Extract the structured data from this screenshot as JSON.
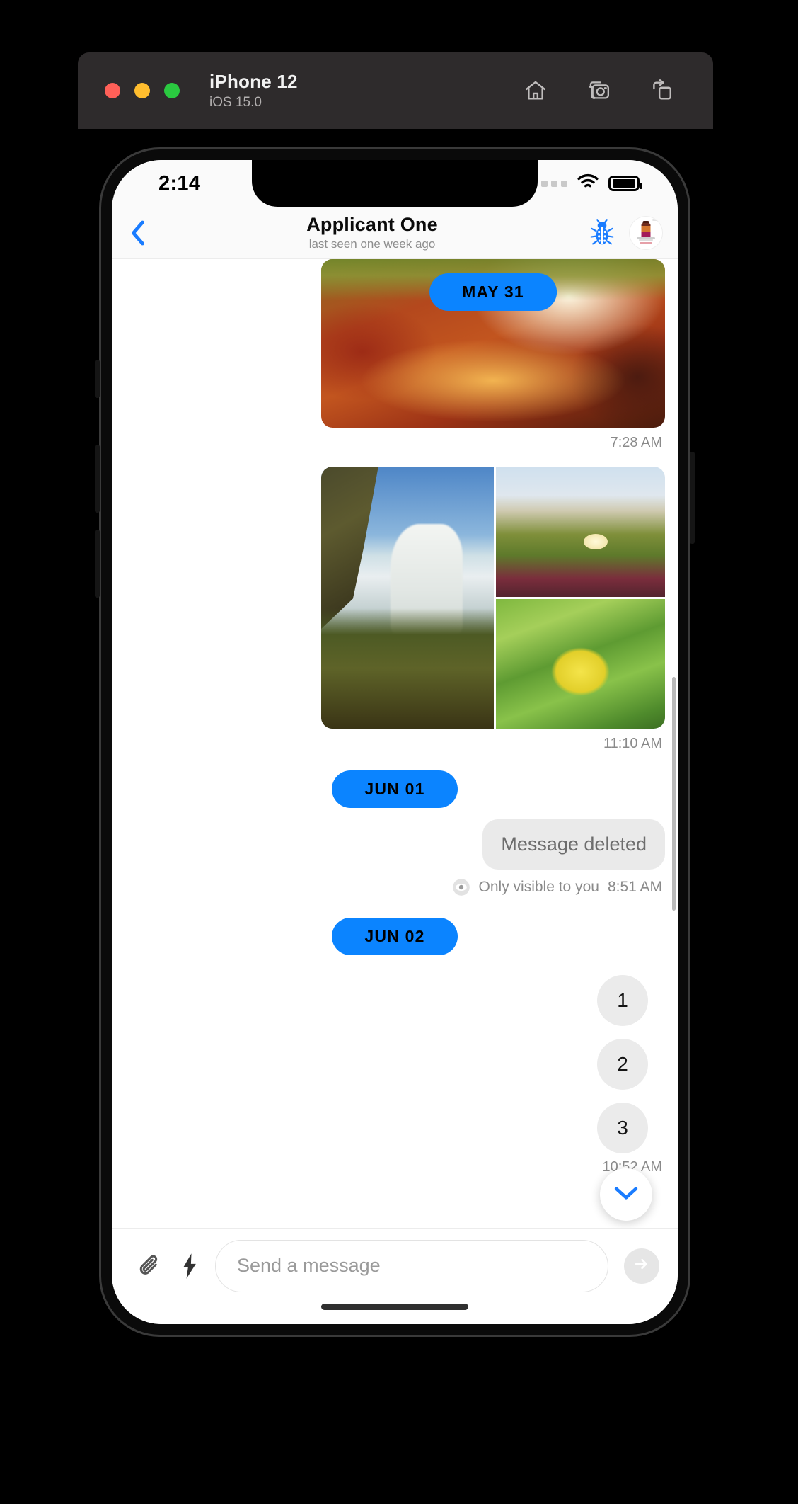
{
  "simulator": {
    "device_name": "iPhone 12",
    "os_version": "iOS 15.0",
    "traffic_lights": [
      "close",
      "minimize",
      "zoom"
    ],
    "toolbar_icons": [
      "home-icon",
      "screenshot-camera-icon",
      "rotate-icon"
    ],
    "colors": {
      "bar_bg": "#2e2b2c",
      "close": "#ff6058",
      "minimize": "#ffbd2e",
      "zoom": "#2ac940"
    }
  },
  "status_bar": {
    "time": "2:14",
    "signal": "signal-dots-icon",
    "wifi": "wifi-icon",
    "battery": "battery-full-icon"
  },
  "chat_header": {
    "back": "chevron-left-icon",
    "title": "Applicant  One",
    "subtitle": "last seen one week ago",
    "bug_icon": "bug-icon",
    "avatar": "avatar",
    "accent": "#0b84ff"
  },
  "messages": [
    {
      "type": "photo",
      "photo_name": "autumn-forest-path",
      "overlay_pill": "MAY 31",
      "timestamp": "7:28 AM"
    },
    {
      "type": "album",
      "photos": [
        "waterfall-mossy-rocks",
        "ice-plant-dune-flowers",
        "lemon-tree-leaves"
      ],
      "timestamp": "11:10 AM"
    },
    {
      "type": "date_pill",
      "label": "JUN 01"
    },
    {
      "type": "deleted",
      "text": "Message deleted",
      "visibility_icon": "eye-icon",
      "visibility_note": "Only visible to you",
      "timestamp": "8:51 AM"
    },
    {
      "type": "date_pill",
      "label": "JUN 02"
    },
    {
      "type": "counter",
      "label": "1"
    },
    {
      "type": "counter",
      "label": "2"
    },
    {
      "type": "counter",
      "label": "3"
    }
  ],
  "last_timestamp": "10:52 AM",
  "scroll_to_bottom": "chevron-down-icon",
  "composer": {
    "attach_icon": "paperclip-icon",
    "quick_icon": "lightning-bolt-icon",
    "placeholder": "Send a message",
    "value": "",
    "send_icon": "send-arrow-icon"
  },
  "home_indicator": "home-indicator"
}
